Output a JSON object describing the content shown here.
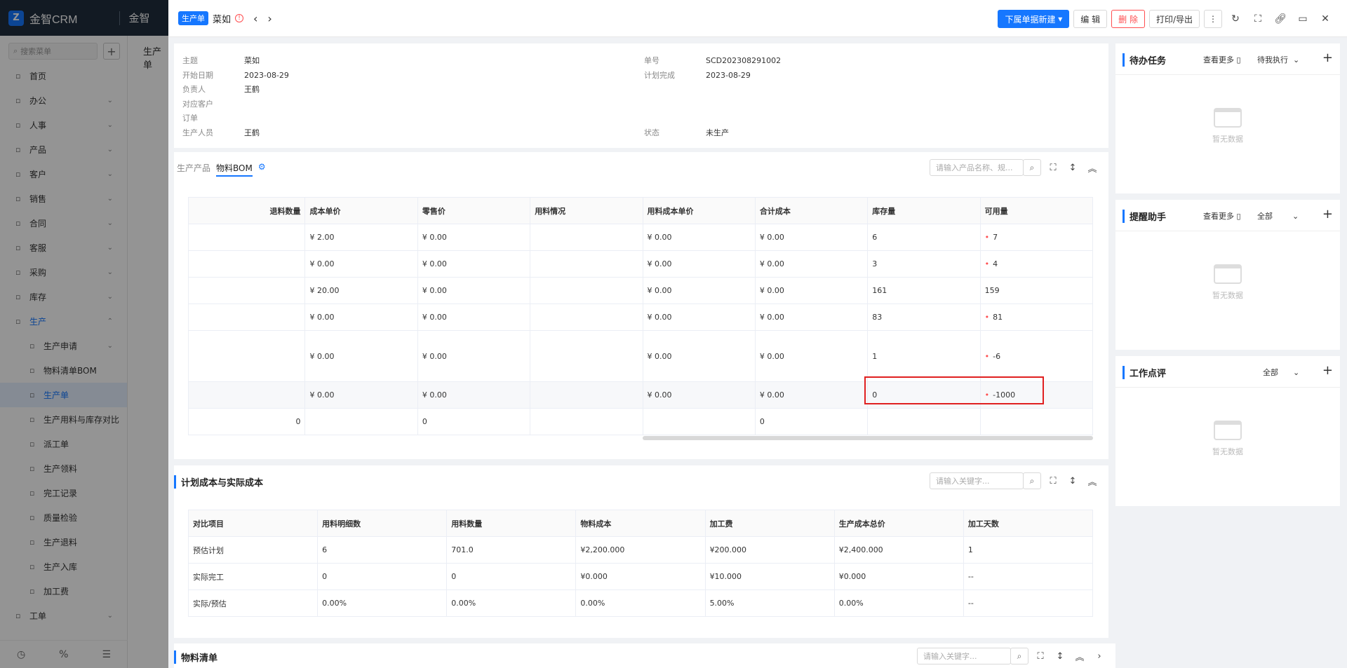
{
  "app": {
    "name": "金智CRM",
    "second": "金智",
    "bg_title": "生产单"
  },
  "sidebar": {
    "search_placeholder": "搜索菜单",
    "items": [
      {
        "icon": "home-icon",
        "label": "首页"
      },
      {
        "icon": "office-icon",
        "label": "办公"
      },
      {
        "icon": "people-icon",
        "label": "人事"
      },
      {
        "icon": "product-icon",
        "label": "产品"
      },
      {
        "icon": "customer-icon",
        "label": "客户"
      },
      {
        "icon": "sales-icon",
        "label": "销售"
      },
      {
        "icon": "contract-icon",
        "label": "合同"
      },
      {
        "icon": "service-icon",
        "label": "客服"
      },
      {
        "icon": "purchase-icon",
        "label": "采购"
      },
      {
        "icon": "stock-icon",
        "label": "库存"
      },
      {
        "icon": "production-icon",
        "label": "生产"
      }
    ],
    "sub_items": [
      "生产申请",
      "物料清单BOM",
      "生产单",
      "生产用料与库存对比",
      "派工单",
      "生产领料",
      "完工记录",
      "质量检验",
      "生产退料",
      "生产入库",
      "加工费"
    ],
    "last": "工单"
  },
  "drawer": {
    "tag": "生产单",
    "title": "菜如",
    "buttons": {
      "new": "下属单据新建",
      "edit": "编 辑",
      "delete": "删 除",
      "print": "打印/导出"
    }
  },
  "info": {
    "subject_k": "主题",
    "subject_v": "菜如",
    "start_k": "开始日期",
    "start_v": "2023-08-29",
    "owner_k": "负责人",
    "owner_v": "王鹤",
    "cust_k": "对应客户",
    "order_k": "订单",
    "staff_k": "生产人员",
    "staff_v": "王鹤",
    "no_k": "单号",
    "no_v": "SCD202308291002",
    "plan_k": "计划完成",
    "plan_v": "2023-08-29",
    "status_k": "状态",
    "status_v": "未生产"
  },
  "bom": {
    "tab1": "生产产品",
    "tab2": "物料BOM",
    "search_placeholder": "请输入产品名称、规...",
    "headers": [
      "退料数量",
      "成本单价",
      "零售价",
      "用料情况",
      "用料成本单价",
      "合计成本",
      "库存量",
      "可用量"
    ],
    "rows": [
      [
        "",
        "¥ 2.00",
        "¥ 0.00",
        "",
        "¥ 0.00",
        "¥ 0.00",
        "6",
        "7"
      ],
      [
        "",
        "¥ 0.00",
        "¥ 0.00",
        "",
        "¥ 0.00",
        "¥ 0.00",
        "3",
        "4"
      ],
      [
        "",
        "¥ 20.00",
        "¥ 0.00",
        "",
        "¥ 0.00",
        "¥ 0.00",
        "161",
        "159"
      ],
      [
        "",
        "¥ 0.00",
        "¥ 0.00",
        "",
        "¥ 0.00",
        "¥ 0.00",
        "83",
        "81"
      ],
      [
        "",
        "¥ 0.00",
        "¥ 0.00",
        "",
        "¥ 0.00",
        "¥ 0.00",
        "1",
        "-6"
      ],
      [
        "",
        "¥ 0.00",
        "¥ 0.00",
        "",
        "¥ 0.00",
        "¥ 0.00",
        "0",
        "-1000"
      ]
    ],
    "red_flags": [
      true,
      true,
      false,
      true,
      true,
      true
    ],
    "footer": [
      "0",
      "",
      "0",
      "",
      "",
      "0",
      "",
      ""
    ]
  },
  "cost": {
    "title": "计划成本与实际成本",
    "search_placeholder": "请输入关键字...",
    "headers": [
      "对比项目",
      "用料明细数",
      "用料数量",
      "物料成本",
      "加工费",
      "生产成本总价",
      "加工天数"
    ],
    "rows": [
      [
        "预估计划",
        "6",
        "701.0",
        "¥2,200.000",
        "¥200.000",
        "¥2,400.000",
        "1"
      ],
      [
        "实际完工",
        "0",
        "0",
        "¥0.000",
        "¥10.000",
        "¥0.000",
        "--"
      ],
      [
        "实际/预估",
        "0.00%",
        "0.00%",
        "0.00%",
        "5.00%",
        "0.00%",
        "--"
      ]
    ]
  },
  "materials": {
    "title": "物料清单",
    "search_placeholder": "请输入关键字..."
  },
  "right": {
    "todo": {
      "title": "待办任务",
      "more": "查看更多",
      "select": "待我执行",
      "empty": "暂无数据"
    },
    "remind": {
      "title": "提醒助手",
      "more": "查看更多",
      "select": "全部",
      "empty": "暂无数据"
    },
    "review": {
      "title": "工作点评",
      "select": "全部",
      "empty": "暂无数据"
    }
  }
}
